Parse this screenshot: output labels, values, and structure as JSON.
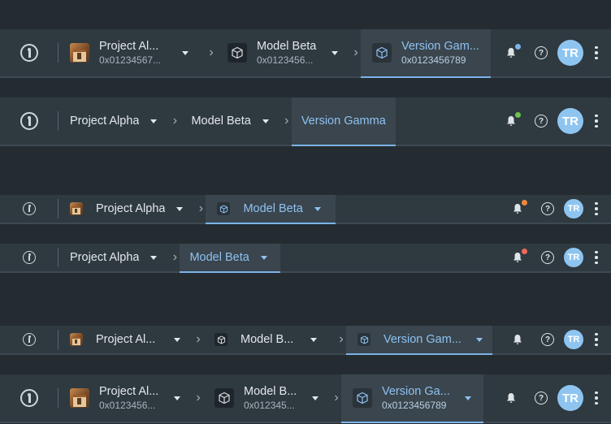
{
  "bars": [
    {
      "crumbs": [
        {
          "icon": "project-thumbnail",
          "title": "Project Al...",
          "sub": "0x01234567...",
          "active": false
        },
        {
          "icon": "cube-icon",
          "title": "Model Beta",
          "sub": "0x0123456...",
          "active": false
        },
        {
          "icon": "cube-icon",
          "title": "Version Gam...",
          "sub": "0x0123456789",
          "active": true
        }
      ],
      "notification_dot_color": "#7db3e8",
      "avatar_initials": "TR"
    },
    {
      "crumbs": [
        {
          "title": "Project Alpha",
          "active": false
        },
        {
          "title": "Model Beta",
          "active": false
        },
        {
          "title": "Version Gamma",
          "active": true
        }
      ],
      "notification_dot_color": "#6cc24a",
      "avatar_initials": "TR"
    },
    {
      "crumbs": [
        {
          "icon": "project-thumbnail",
          "title": "Project Alpha",
          "active": false
        },
        {
          "icon": "cube-icon",
          "title": "Model Beta",
          "active": true
        }
      ],
      "notification_dot_color": "#f0883e",
      "avatar_initials": "TR"
    },
    {
      "crumbs": [
        {
          "title": "Project Alpha",
          "active": false
        },
        {
          "title": "Model Beta",
          "active": true
        }
      ],
      "notification_dot_color": "#f06a5a",
      "avatar_initials": "TR"
    },
    {
      "crumbs": [
        {
          "icon": "project-thumbnail",
          "title": "Project Al...",
          "active": false
        },
        {
          "icon": "cube-icon",
          "title": "Model B...",
          "active": false
        },
        {
          "icon": "cube-icon",
          "title": "Version Gam...",
          "active": true
        }
      ],
      "avatar_initials": "TR"
    },
    {
      "crumbs": [
        {
          "icon": "project-thumbnail",
          "title": "Project Al...",
          "sub": "0x0123456...",
          "active": false
        },
        {
          "icon": "cube-icon",
          "title": "Model B...",
          "sub": "0x012345...",
          "active": false
        },
        {
          "icon": "cube-icon",
          "title": "Version Ga...",
          "sub": "0x0123456789",
          "active": true
        }
      ],
      "avatar_initials": "TR"
    }
  ],
  "help_label": "?"
}
